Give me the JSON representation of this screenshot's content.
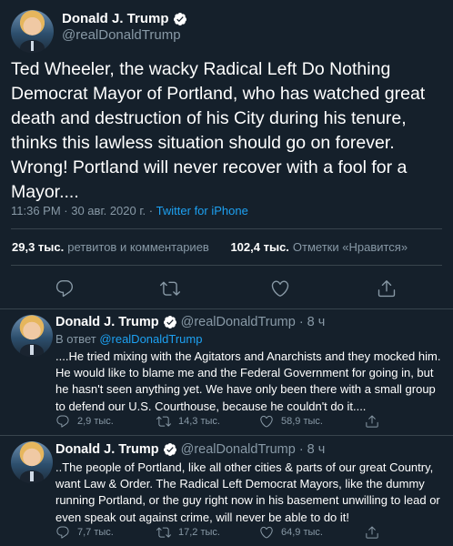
{
  "main_tweet": {
    "author_name": "Donald J. Trump",
    "handle": "@realDonaldTrump",
    "text": "Ted Wheeler, the wacky Radical Left Do Nothing Democrat Mayor of Portland, who has watched great death and destruction of his City during his tenure, thinks this lawless situation should go on forever. Wrong! Portland will never recover with a fool for a Mayor....",
    "time": "11:36 PM · 30 авг. 2020 г. · ",
    "source": "Twitter for iPhone",
    "retweets_count": "29,3 тыс.",
    "retweets_label": "ретвитов и комментариев",
    "likes_count": "102,4 тыс.",
    "likes_label": "Отметки «Нравится»"
  },
  "replies": [
    {
      "author_name": "Donald J. Trump",
      "handle_time": "@realDonaldTrump · 8 ч",
      "reply_prefix": "В ответ ",
      "reply_to": "@realDonaldTrump",
      "text": "....He tried mixing with the Agitators and Anarchists and they mocked him. He would like to blame me and the Federal Government for going in, but he hasn't seen anything yet. We have only been there with a small group to defend our U.S. Courthouse, because he couldn't do it....",
      "replies": "2,9 тыс.",
      "retweets": "14,3 тыс.",
      "likes": "58,9 тыс."
    },
    {
      "author_name": "Donald J. Trump",
      "handle_time": "@realDonaldTrump · 8 ч",
      "text": "..The people of Portland, like all other cities &  parts of our great Country, want Law & Order. The Radical Left Democrat Mayors, like the dummy running Portland, or the guy right now in his basement unwilling to lead or even speak out against crime, will never be able to do it!",
      "replies": "7,7 тыс.",
      "retweets": "17,2 тыс.",
      "likes": "64,9 тыс."
    }
  ],
  "icons": {
    "verified": "verified-badge-icon",
    "reply": "reply-icon",
    "retweet": "retweet-icon",
    "like": "heart-icon",
    "share": "share-icon"
  },
  "colors": {
    "background": "#15202b",
    "divider": "#38444d",
    "secondary_text": "#8899a6",
    "link": "#1da1f2"
  }
}
